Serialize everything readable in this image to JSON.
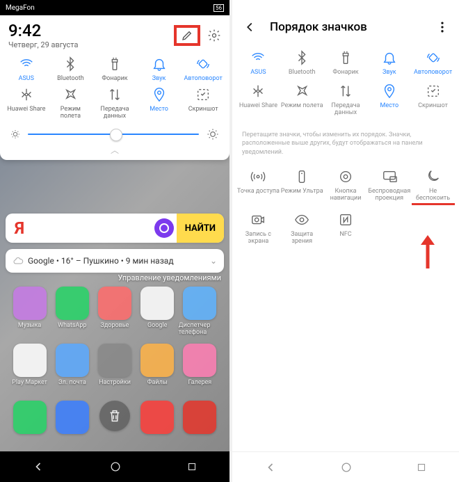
{
  "left": {
    "status": {
      "carrier": "MegaFon",
      "battery": "56"
    },
    "time": "9:42",
    "date": "Четверг, 29 августа",
    "qs": [
      {
        "label": "ASUS",
        "icon": "wifi",
        "active": true
      },
      {
        "label": "Bluetooth",
        "icon": "bluetooth",
        "active": false
      },
      {
        "label": "Фонарик",
        "icon": "flashlight",
        "active": false
      },
      {
        "label": "Звук",
        "icon": "bell",
        "active": true
      },
      {
        "label": "Автоповорот",
        "icon": "rotate",
        "active": true
      },
      {
        "label": "Huawei Share",
        "icon": "huaweishare",
        "active": false
      },
      {
        "label": "Режим полета",
        "icon": "airplane",
        "active": false
      },
      {
        "label": "Передача данных",
        "icon": "mobiledata",
        "active": false
      },
      {
        "label": "Место",
        "icon": "location",
        "active": true
      },
      {
        "label": "Скриншот",
        "icon": "screenshot",
        "active": false
      }
    ],
    "search": {
      "logo": "Я",
      "find": "НАЙТИ"
    },
    "weather": "Google • 16° – Пушкино • 9 мин назад",
    "notif": "Управление уведомлениями",
    "apps_row1": [
      {
        "label": "Музыка",
        "bg": "#c679e6"
      },
      {
        "label": "WhatsApp",
        "bg": "#25d366"
      },
      {
        "label": "Здоровье",
        "bg": "#ff6b6b"
      },
      {
        "label": "Google",
        "bg": "#fff"
      },
      {
        "label": "Диспетчер телефона",
        "bg": "#5eb3ff"
      }
    ],
    "apps_row2": [
      {
        "label": "Play Маркет",
        "bg": "#fff"
      },
      {
        "label": "Эл. почта",
        "bg": "#5aa9ff"
      },
      {
        "label": "Настройки",
        "bg": "#888"
      },
      {
        "label": "Файлы",
        "bg": "#ffb347"
      },
      {
        "label": "Галерея",
        "bg": "#ff7eb3"
      }
    ],
    "apps_row3": [
      {
        "label": "",
        "bg": "#25d366"
      },
      {
        "label": "",
        "bg": "#3a7eff"
      },
      {
        "label": "",
        "bg": "trash"
      },
      {
        "label": "",
        "bg": "#fc3d39"
      },
      {
        "label": "",
        "bg": "#e5352b"
      }
    ]
  },
  "right": {
    "title": "Порядок значков",
    "qs_top": [
      {
        "label": "ASUS",
        "icon": "wifi",
        "active": true
      },
      {
        "label": "Bluetooth",
        "icon": "bluetooth",
        "active": false
      },
      {
        "label": "Фонарик",
        "icon": "flashlight",
        "active": false
      },
      {
        "label": "Звук",
        "icon": "bell",
        "active": true
      },
      {
        "label": "Автоповорот",
        "icon": "rotate",
        "active": true
      },
      {
        "label": "Huawei Share",
        "icon": "huaweishare",
        "active": false
      },
      {
        "label": "Режим полета",
        "icon": "airplane",
        "active": false
      },
      {
        "label": "Передача данных",
        "icon": "mobiledata",
        "active": false
      },
      {
        "label": "Место",
        "icon": "location",
        "active": true
      },
      {
        "label": "Скриншот",
        "icon": "screenshot",
        "active": false
      }
    ],
    "hint": "Перетащите значки, чтобы изменить их порядок. Значки, расположенные выше других, будут отображаться на панели уведомлений.",
    "qs_bottom": [
      {
        "label": "Точка доступа",
        "icon": "hotspot"
      },
      {
        "label": "Режим Ультра",
        "icon": "ultra"
      },
      {
        "label": "Кнопка навигации",
        "icon": "navbutton"
      },
      {
        "label": "Беспроводная проекция",
        "icon": "cast"
      },
      {
        "label": "Не беспокоить",
        "icon": "dnd",
        "highlight": true
      },
      {
        "label": "Запись с экрана",
        "icon": "record"
      },
      {
        "label": "Защита зрения",
        "icon": "eye"
      },
      {
        "label": "NFC",
        "icon": "nfc"
      },
      {
        "label": "",
        "icon": ""
      },
      {
        "label": "",
        "icon": ""
      }
    ]
  }
}
